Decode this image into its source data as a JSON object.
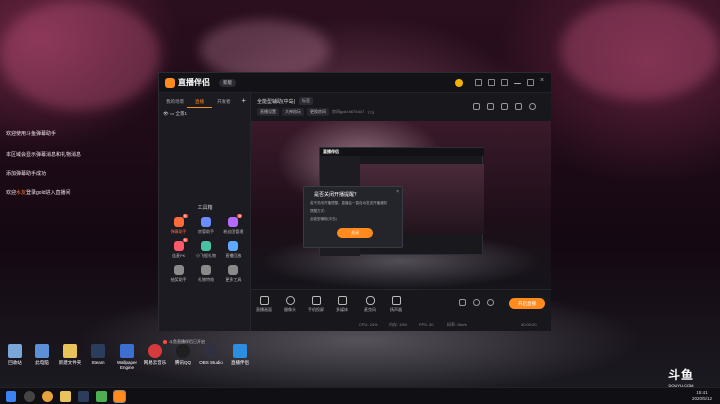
{
  "desktop": {
    "text_lines": [
      {
        "pre": "欢迎使用斗鱼弹幕助手",
        "hl": "",
        "post": ""
      },
      {
        "pre": "本区域会显示弹幕消息和礼物消息",
        "hl": "",
        "post": ""
      },
      {
        "pre": "添加弹幕助手成功",
        "hl": "",
        "post": ""
      },
      {
        "pre": "欢迎",
        "hl": "水友",
        "post": "登录gold进入直播间"
      }
    ],
    "icons": [
      {
        "label": "回收站",
        "color": "#7aa6d8"
      },
      {
        "label": "此电脑",
        "color": "#5c8fd6"
      },
      {
        "label": "新建文件夹",
        "color": "#e8c35a"
      },
      {
        "label": "Steam",
        "color": "#2a3d5c"
      },
      {
        "label": "Wallpaper Engine",
        "color": "#3d6fd1"
      },
      {
        "label": "网易云音乐",
        "color": "#d63b3b"
      },
      {
        "label": "腾讯QQ",
        "color": "#1f1f1f"
      },
      {
        "label": "OBS Studio",
        "color": "#303040"
      },
      {
        "label": "直播伴侣",
        "color": "#2d8de0"
      }
    ],
    "watermark": "斗鱼",
    "watermark_sub": "DOUYU.COM",
    "clock_time": "15:41",
    "clock_date": "2020/5/12"
  },
  "app": {
    "name": "直播伴侣",
    "version_chip": "新版",
    "left_tabs": [
      "我的场景",
      "直播",
      "开发者"
    ],
    "active_left_tab": 1,
    "scene_name": "全景1",
    "tools_header": "工具箱",
    "tools": [
      {
        "label": "弹幕助手",
        "hot": true,
        "badge": "新",
        "color": "#ff6a3a"
      },
      {
        "label": "房管助手",
        "hot": false,
        "badge": "",
        "color": "#6a8cff"
      },
      {
        "label": "粉丝团管理",
        "hot": false,
        "badge": "新",
        "color": "#b36aff"
      },
      {
        "label": "连麦PK",
        "hot": false,
        "badge": "新",
        "color": "#ff5a6a"
      },
      {
        "label": "小飞棍礼物",
        "hot": false,
        "badge": "",
        "color": "#4ac1a3"
      },
      {
        "label": "直播回放",
        "hot": false,
        "badge": "",
        "color": "#5ca9ff"
      },
      {
        "label": "抽奖助手",
        "hot": false,
        "badge": "",
        "color": "#8a8a8a"
      },
      {
        "label": "礼物特效",
        "hot": false,
        "badge": "",
        "color": "#8a8a8a"
      },
      {
        "label": "更多工具",
        "hot": false,
        "badge": "",
        "color": "#8a8a8a"
      }
    ],
    "left_footer": "斗鱼直播伴侣已开启",
    "header": {
      "title": "全能型辅助(中岛)",
      "tag": "标签",
      "chips": [
        "直播设置",
        "大神陪玩"
      ],
      "room_text": "房间gold 8675447",
      "hot_text": "773",
      "action_chip": "更换房间"
    },
    "dialog": {
      "question": "是否关闭开播提醒？",
      "desc1": "若不关闭开播提醒，直播会一直自动发送开播通知",
      "desc2": "提醒方式：",
      "desc3": "全能型辅助(中岛)",
      "button": "关闭"
    },
    "bottom_tools": [
      "直播画面",
      "摄像头",
      "手机投屏",
      "多媒体",
      "麦克风",
      "扬声器"
    ],
    "go_live": "开启直播",
    "stats": {
      "cpu": "CPU: 24%",
      "mem": "内存: 33%",
      "fps": "FPS: 30",
      "bitrate": "码率: 0kb/s",
      "timer": "00:00:00"
    }
  }
}
